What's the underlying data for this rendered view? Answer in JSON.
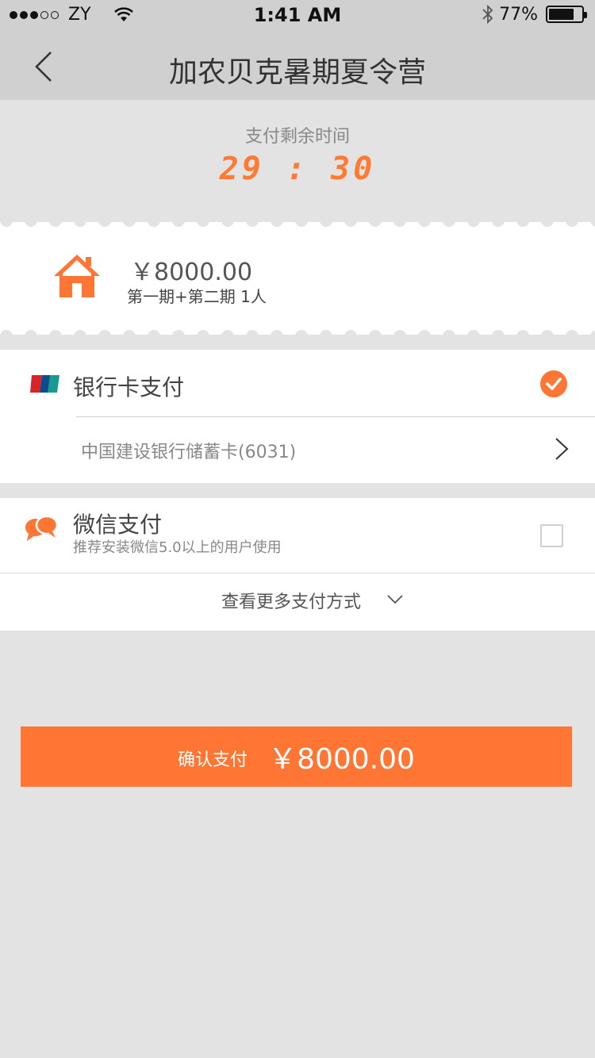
{
  "status_bar": {
    "carrier": "ZY",
    "time": "1:41 AM",
    "battery_text": "77%",
    "battery_level": 0.77,
    "signal_bars_filled": 3,
    "signal_bars_total": 5
  },
  "nav": {
    "title": "加农贝克暑期夏令营"
  },
  "countdown": {
    "label": "支付剩余时间",
    "value": "29 : 30"
  },
  "order": {
    "price": "￥8000.00",
    "description": "第一期+第二期  1人"
  },
  "payment_methods": {
    "bank_card": {
      "label": "银行卡支付",
      "selected": true,
      "card_name": "中国建设银行储蓄卡(6031)"
    },
    "wechat": {
      "label": "微信支付",
      "subtitle": "推荐安装微信5.0以上的用户使用",
      "selected": false
    },
    "more_label": "查看更多支付方式"
  },
  "confirm": {
    "label": "确认支付",
    "amount": "￥8000.00"
  },
  "colors": {
    "accent": "#ff7533",
    "countdown": "#ff7a33",
    "header_bg": "#d0d0d0",
    "page_bg": "#e3e3e3"
  },
  "icons": {
    "back": "chevron-left-icon",
    "house": "house-icon",
    "unionpay": "unionpay-icon",
    "check": "check-circle-icon",
    "arrow": "chevron-right-icon",
    "wechat": "chat-bubbles-icon",
    "expand": "chevron-down-icon"
  }
}
